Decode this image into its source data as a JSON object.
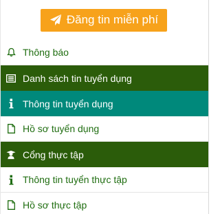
{
  "post_button": {
    "label": "Đăng tin miễn phí",
    "icon": "paper-plane-icon",
    "color": "#f7a21b"
  },
  "menu": {
    "items": [
      {
        "label": "Thông báo",
        "icon": "bell-icon",
        "style": "plain"
      },
      {
        "label": "Danh sách tin tuyển dụng",
        "icon": "list-icon",
        "style": "header"
      },
      {
        "label": "Thông tin tuyển dụng",
        "icon": "info-icon",
        "style": "active"
      },
      {
        "label": "Hồ sơ tuyển dụng",
        "icon": "document-icon",
        "style": "plain"
      },
      {
        "label": "Cổng thực tập",
        "icon": "graduate-icon",
        "style": "header"
      },
      {
        "label": "Thông tin tuyển thực tập",
        "icon": "info-icon",
        "style": "plain"
      },
      {
        "label": "Hồ sơ thực tập",
        "icon": "document-icon",
        "style": "plain"
      }
    ]
  },
  "colors": {
    "header_bg": "#2b5c0a",
    "active_bg": "#00897b",
    "text_green": "#1f6d10"
  }
}
